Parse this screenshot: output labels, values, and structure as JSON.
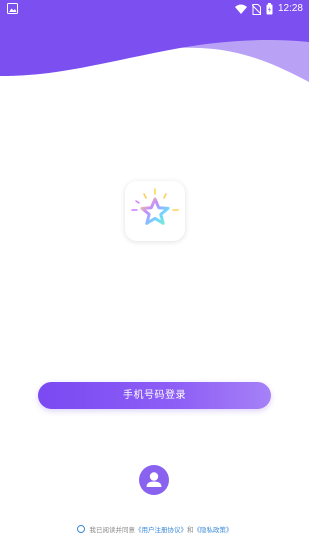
{
  "status_bar": {
    "time": "12:28",
    "icons": [
      "image-icon",
      "wifi-icon",
      "no-sim-icon",
      "battery-icon"
    ]
  },
  "colors": {
    "wave_primary": "#7b4ff0",
    "wave_secondary": "#b9a2f6",
    "button_start": "#7a49f2",
    "button_end": "#a681f7",
    "link": "#3a8ad8"
  },
  "login": {
    "phone_button_label": "手机号码登录"
  },
  "account_icon": "user-icon",
  "agreement": {
    "prefix": "我已阅读并同意",
    "user_agreement": "《用户注册协议》",
    "conjunction": "和",
    "privacy_policy": "《隐私政策》"
  }
}
